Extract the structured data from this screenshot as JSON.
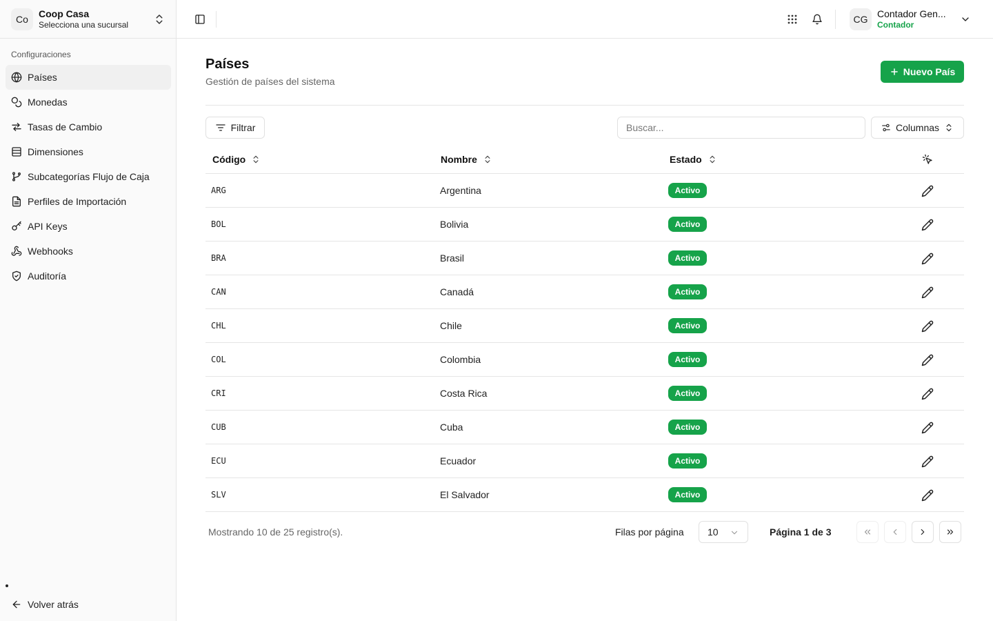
{
  "org": {
    "avatar": "Co",
    "name": "Coop Casa",
    "subtitle": "Selecciona una sucursal"
  },
  "sidebar": {
    "section_label": "Configuraciones",
    "items": [
      {
        "label": "Países",
        "icon": "globe-icon",
        "active": true
      },
      {
        "label": "Monedas",
        "icon": "coins-icon"
      },
      {
        "label": "Tasas de Cambio",
        "icon": "arrows-exchange-icon"
      },
      {
        "label": "Dimensiones",
        "icon": "layers-icon"
      },
      {
        "label": "Subcategorías Flujo de Caja",
        "icon": "git-branch-icon"
      },
      {
        "label": "Perfiles de Importación",
        "icon": "file-text-icon"
      },
      {
        "label": "API Keys",
        "icon": "key-icon"
      },
      {
        "label": "Webhooks",
        "icon": "webhook-icon"
      },
      {
        "label": "Auditoría",
        "icon": "shield-check-icon"
      }
    ],
    "back_label": "Volver atrás"
  },
  "user": {
    "initials": "CG",
    "name": "Contador Gen...",
    "role": "Contador"
  },
  "page": {
    "title": "Países",
    "subtitle": "Gestión de países del sistema",
    "new_button": "Nuevo País"
  },
  "toolbar": {
    "filter_label": "Filtrar",
    "search_placeholder": "Buscar...",
    "columns_label": "Columnas"
  },
  "table": {
    "headers": {
      "code": "Código",
      "name": "Nombre",
      "status": "Estado"
    },
    "rows": [
      {
        "code": "ARG",
        "name": "Argentina",
        "status": "Activo"
      },
      {
        "code": "BOL",
        "name": "Bolivia",
        "status": "Activo"
      },
      {
        "code": "BRA",
        "name": "Brasil",
        "status": "Activo"
      },
      {
        "code": "CAN",
        "name": "Canadá",
        "status": "Activo"
      },
      {
        "code": "CHL",
        "name": "Chile",
        "status": "Activo"
      },
      {
        "code": "COL",
        "name": "Colombia",
        "status": "Activo"
      },
      {
        "code": "CRI",
        "name": "Costa Rica",
        "status": "Activo"
      },
      {
        "code": "CUB",
        "name": "Cuba",
        "status": "Activo"
      },
      {
        "code": "ECU",
        "name": "Ecuador",
        "status": "Activo"
      },
      {
        "code": "SLV",
        "name": "El Salvador",
        "status": "Activo"
      }
    ]
  },
  "pagination": {
    "showing": "Mostrando 10 de 25 registro(s).",
    "rows_per_page_label": "Filas por página",
    "rows_per_page_value": "10",
    "page_info": "Página 1 de 3"
  },
  "colors": {
    "accent": "#16a34a",
    "border": "#e5e5e5",
    "sidebar_bg": "#fafafa"
  }
}
